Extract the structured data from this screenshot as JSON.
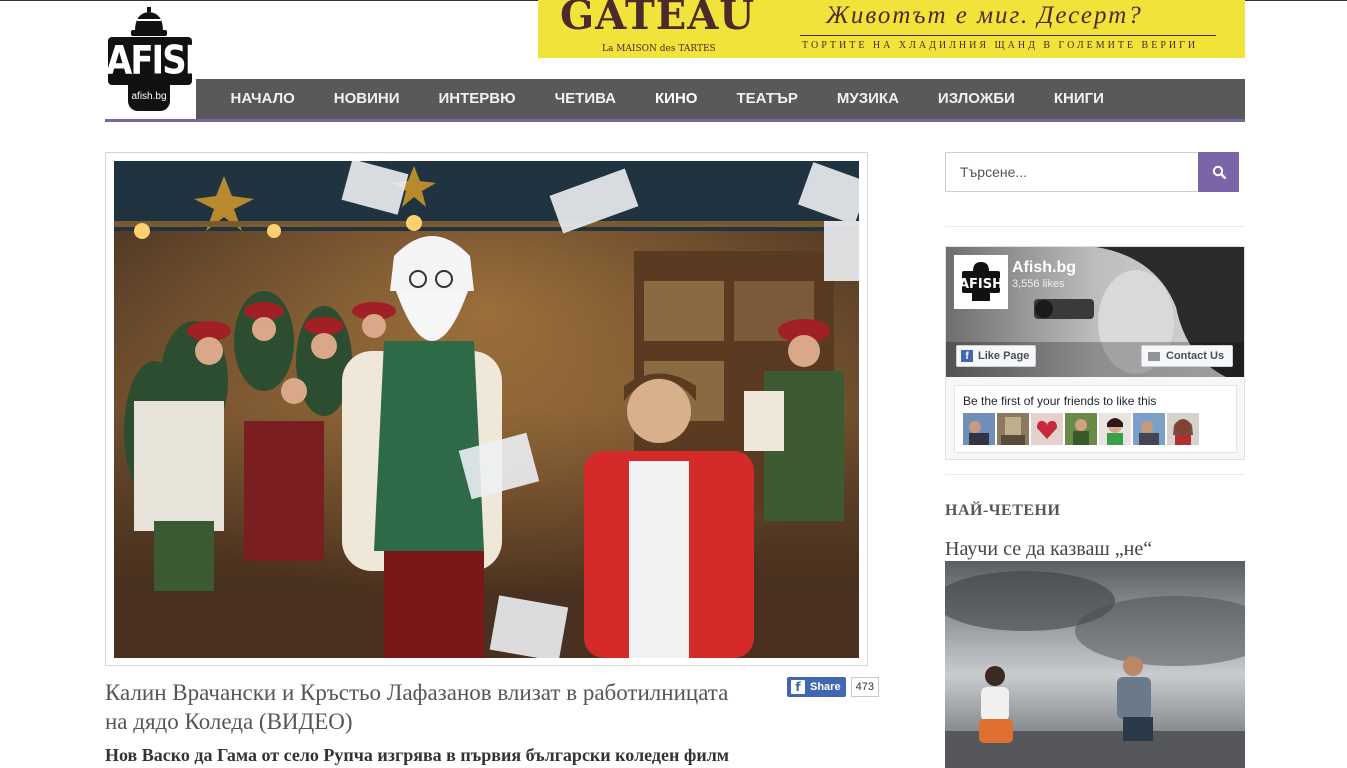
{
  "site": {
    "logo_text": "AFISH",
    "logo_url": "afish.bg"
  },
  "banner": {
    "brand": "GATEAU",
    "subtitle": "La MAISON des TARTES",
    "slogan": "Животът е миг. Десерт?",
    "tagline": "ТОРТИТЕ НА ХЛАДИЛНИЯ ЩАНД В ГОЛЕМИТЕ ВЕРИГИ"
  },
  "nav": {
    "items": [
      {
        "label": "НАЧАЛО"
      },
      {
        "label": "НОВИНИ"
      },
      {
        "label": "ИНТЕРВЮ"
      },
      {
        "label": "ЧЕТИВА"
      },
      {
        "label": "КИНО"
      },
      {
        "label": "ТЕАТЪР"
      },
      {
        "label": "МУЗИКА"
      },
      {
        "label": "ИЗЛОЖБИ"
      },
      {
        "label": "КНИГИ"
      }
    ],
    "active_index": 4
  },
  "article": {
    "title": "Калин Врачански и Кръстьо Лафазанов влизат в работилницата на дядо Коледа (ВИДЕО)",
    "subtitle": "Нов Васко да Гама от село Рупча изгрява в първия български коледен филм",
    "share_label": "Share",
    "share_count": "473"
  },
  "sidebar": {
    "search_placeholder": "Търсене...",
    "facebook": {
      "page_name": "Afish.bg",
      "likes": "3,556 likes",
      "like_button": "Like Page",
      "contact_button": "Contact Us",
      "friends_text": "Be the first of your friends to like this",
      "avatar_text": "AFISH"
    },
    "most_read_heading": "НАЙ-ЧЕТЕНИ",
    "most_read_title": "Научи се да казваш „не“"
  },
  "colors": {
    "accent": "#7b64a8",
    "nav_bg": "#595959",
    "banner_bg": "#f2e33a",
    "facebook_blue": "#4267b2"
  }
}
